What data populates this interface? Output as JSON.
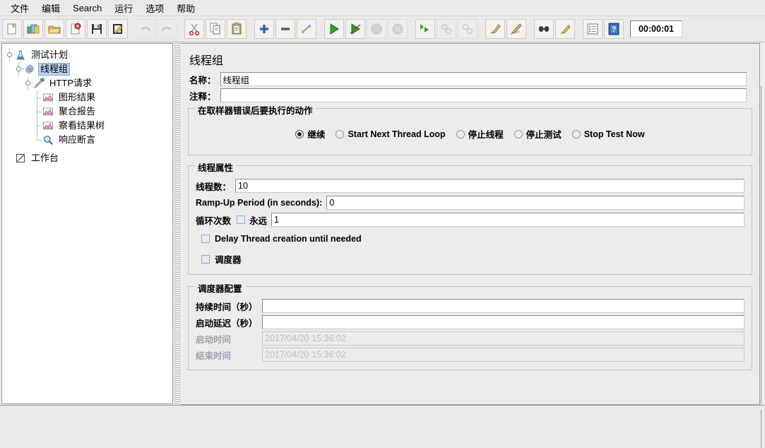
{
  "menu": {
    "items": [
      {
        "label": "文件",
        "name": "menu-file"
      },
      {
        "label": "编辑",
        "name": "menu-edit"
      },
      {
        "label": "Search",
        "name": "menu-search"
      },
      {
        "label": "运行",
        "name": "menu-run"
      },
      {
        "label": "选项",
        "name": "menu-options"
      },
      {
        "label": "帮助",
        "name": "menu-help"
      }
    ]
  },
  "toolbar": {
    "timer_value": "00:00:01",
    "buttons": [
      {
        "icon": "new-file-icon",
        "enabled": true
      },
      {
        "icon": "templates-icon",
        "enabled": true
      },
      {
        "icon": "open-folder-icon",
        "enabled": true
      },
      {
        "icon": "close-file-icon",
        "enabled": true
      },
      {
        "icon": "save-icon",
        "enabled": true
      },
      {
        "icon": "save-as-icon",
        "enabled": true
      },
      {
        "icon": "undo-icon",
        "enabled": false
      },
      {
        "icon": "redo-icon",
        "enabled": false
      },
      {
        "icon": "cut-icon",
        "enabled": true
      },
      {
        "icon": "copy-icon",
        "enabled": true
      },
      {
        "icon": "paste-icon",
        "enabled": true
      },
      {
        "icon": "expand-all-icon",
        "enabled": true
      },
      {
        "icon": "collapse-all-icon",
        "enabled": true
      },
      {
        "icon": "toggle-icon",
        "enabled": true
      },
      {
        "icon": "start-icon",
        "enabled": true
      },
      {
        "icon": "start-no-pauses-icon",
        "enabled": true
      },
      {
        "icon": "stop-icon",
        "enabled": false
      },
      {
        "icon": "shutdown-icon",
        "enabled": false
      },
      {
        "icon": "remote-start-all-icon",
        "enabled": true
      },
      {
        "icon": "remote-stop-all-icon",
        "enabled": false
      },
      {
        "icon": "remote-shutdown-all-icon",
        "enabled": false
      },
      {
        "icon": "clear-icon",
        "enabled": true
      },
      {
        "icon": "clear-all-icon",
        "enabled": true
      },
      {
        "icon": "search-icon",
        "enabled": true
      },
      {
        "icon": "search-reset-icon",
        "enabled": true
      },
      {
        "icon": "function-helper-icon",
        "enabled": true
      },
      {
        "icon": "help-icon",
        "enabled": true
      }
    ]
  },
  "tree": {
    "nodes": [
      {
        "label": "测试计划",
        "icon": "test-plan-icon",
        "depth": 0,
        "selected": false,
        "name": "tree-node-test-plan"
      },
      {
        "label": "线程组",
        "icon": "thread-group-icon",
        "depth": 1,
        "selected": true,
        "name": "tree-node-thread-group"
      },
      {
        "label": "HTTP请求",
        "icon": "http-request-icon",
        "depth": 2,
        "selected": false,
        "name": "tree-node-http-request"
      },
      {
        "label": "图形结果",
        "icon": "graph-results-icon",
        "depth": 3,
        "selected": false,
        "name": "tree-node-graph-results"
      },
      {
        "label": "聚合报告",
        "icon": "aggregate-report-icon",
        "depth": 3,
        "selected": false,
        "name": "tree-node-aggregate-report"
      },
      {
        "label": "察看结果树",
        "icon": "view-results-tree-icon",
        "depth": 3,
        "selected": false,
        "name": "tree-node-view-results-tree"
      },
      {
        "label": "响应断言",
        "icon": "assertion-icon",
        "depth": 3,
        "selected": false,
        "name": "tree-node-response-assertion"
      },
      {
        "label": "工作台",
        "icon": "workbench-icon",
        "depth": 0,
        "selected": false,
        "name": "tree-node-workbench"
      }
    ]
  },
  "panel": {
    "title": "线程组",
    "name_label": "名称：",
    "name_value": "线程组",
    "comment_label": "注释：",
    "comment_value": "",
    "on_error": {
      "title": "在取样器错误后要执行的动作",
      "options": [
        {
          "label": "继续",
          "selected": true
        },
        {
          "label": "Start Next Thread Loop",
          "selected": false
        },
        {
          "label": "停止线程",
          "selected": false
        },
        {
          "label": "停止测试",
          "selected": false
        },
        {
          "label": "Stop Test Now",
          "selected": false
        }
      ]
    },
    "thread_props": {
      "title": "线程属性",
      "threads_label": "线程数：",
      "threads_value": "10",
      "rampup_label": "Ramp-Up Period (in seconds):",
      "rampup_value": "0",
      "loops_label": "循环次数",
      "forever_label": "永远",
      "forever_checked": false,
      "loops_value": "1",
      "delay_label": "Delay Thread creation until needed",
      "delay_checked": false,
      "scheduler_label": "调度器",
      "scheduler_checked": false
    },
    "scheduler": {
      "title": "调度器配置",
      "rows": [
        {
          "label": "持续时间（秒）",
          "value": "",
          "disabled": false
        },
        {
          "label": "启动延迟（秒）",
          "value": "",
          "disabled": false
        },
        {
          "label": "启动时间",
          "value": "2017/04/20 15:36:02",
          "disabled": true
        },
        {
          "label": "结束时间",
          "value": "2017/04/20 15:36:02",
          "disabled": true
        }
      ]
    }
  },
  "colors": {
    "selection": "#b8d2f0",
    "panel_bg": "#ececec",
    "tree_bg": "#ffffff",
    "disabled_text": "#b6bfcc"
  }
}
